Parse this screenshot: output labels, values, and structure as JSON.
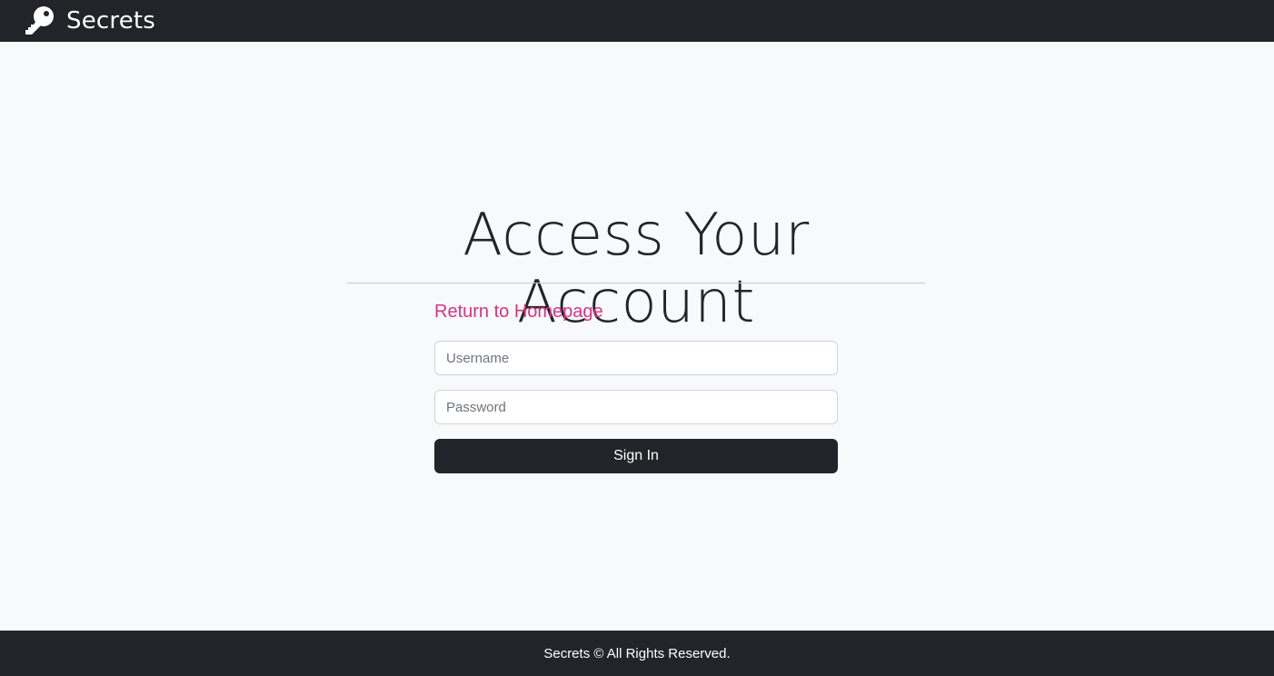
{
  "navbar": {
    "brand": "Secrets",
    "brand_icon": "key-icon",
    "background": "#212529"
  },
  "main": {
    "title": "Access Your Account",
    "home_link": "Return to Homepage",
    "home_link_color": "#d63384",
    "username_placeholder": "Username",
    "username_value": "",
    "password_placeholder": "Password",
    "password_value": "",
    "signin_label": "Sign In"
  },
  "footer": {
    "text": "Secrets © All Rights Reserved."
  }
}
